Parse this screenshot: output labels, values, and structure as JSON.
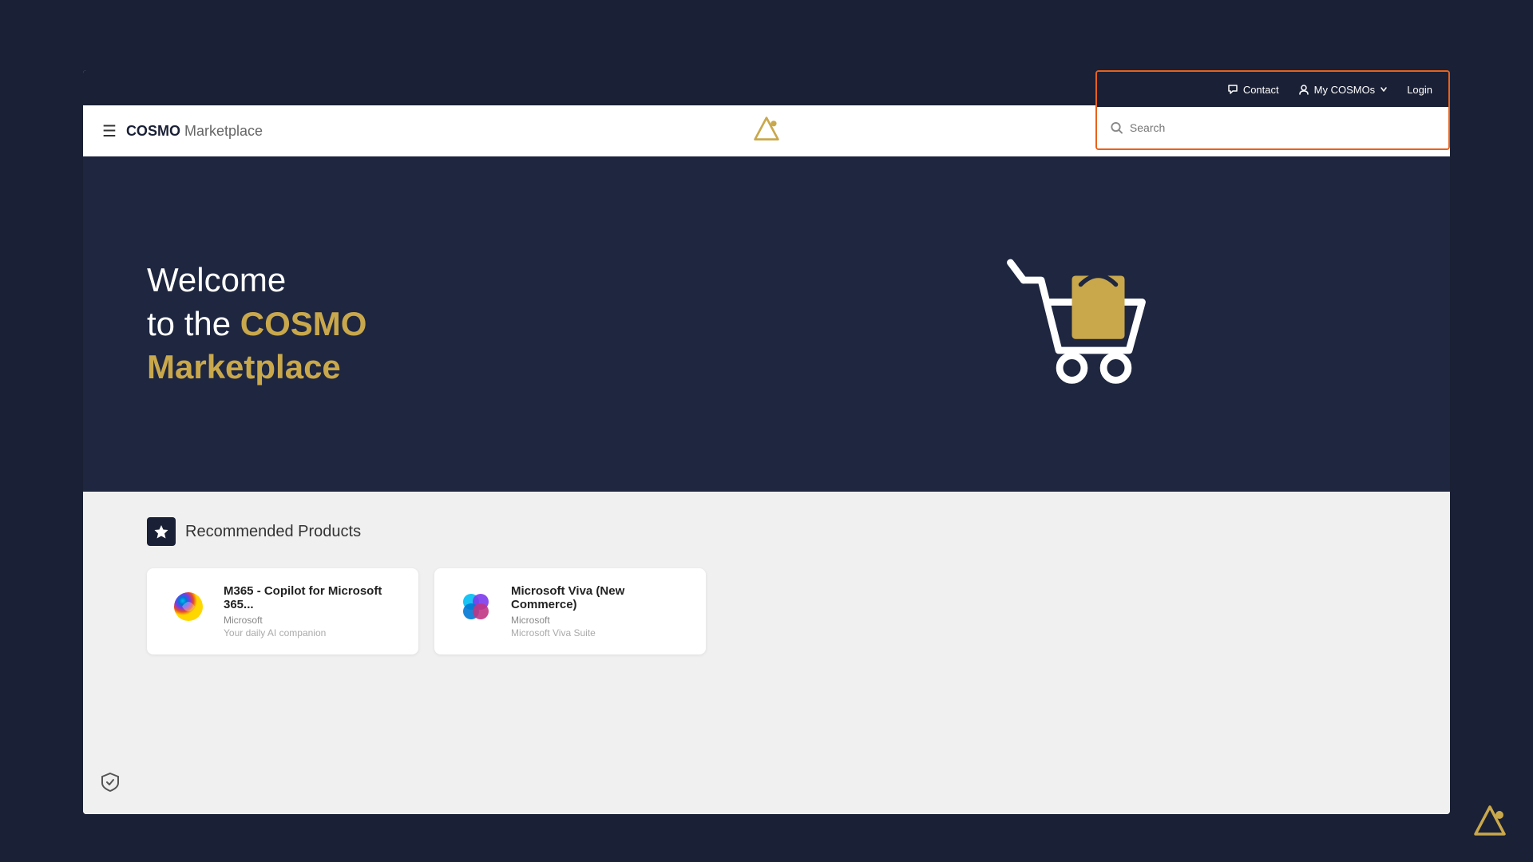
{
  "colors": {
    "dark_bg": "#1a2035",
    "hero_bg": "#1e2640",
    "white": "#ffffff",
    "light_bg": "#f0f0f0",
    "gold": "#c9a84c",
    "orange_border": "#e8611a"
  },
  "header": {
    "brand_cosmo": "COSMO",
    "brand_marketplace": " Marketplace"
  },
  "top_nav": {
    "contact_label": "Contact",
    "my_cosmos_label": "My COSMOs",
    "login_label": "Login"
  },
  "search": {
    "placeholder": "Search"
  },
  "hero": {
    "line1": "Welcome",
    "line2": "to the ",
    "cosmo": "COSMO",
    "marketplace": "Marketplace"
  },
  "recommended": {
    "title": "Recommended Products",
    "products": [
      {
        "name": "M365 - Copilot for Microsoft 365...",
        "brand": "Microsoft",
        "description": "Your daily AI companion"
      },
      {
        "name": "Microsoft Viva (New Commerce)",
        "brand": "Microsoft",
        "description": "Microsoft Viva Suite"
      }
    ]
  },
  "bottom_right_logo": "△·"
}
